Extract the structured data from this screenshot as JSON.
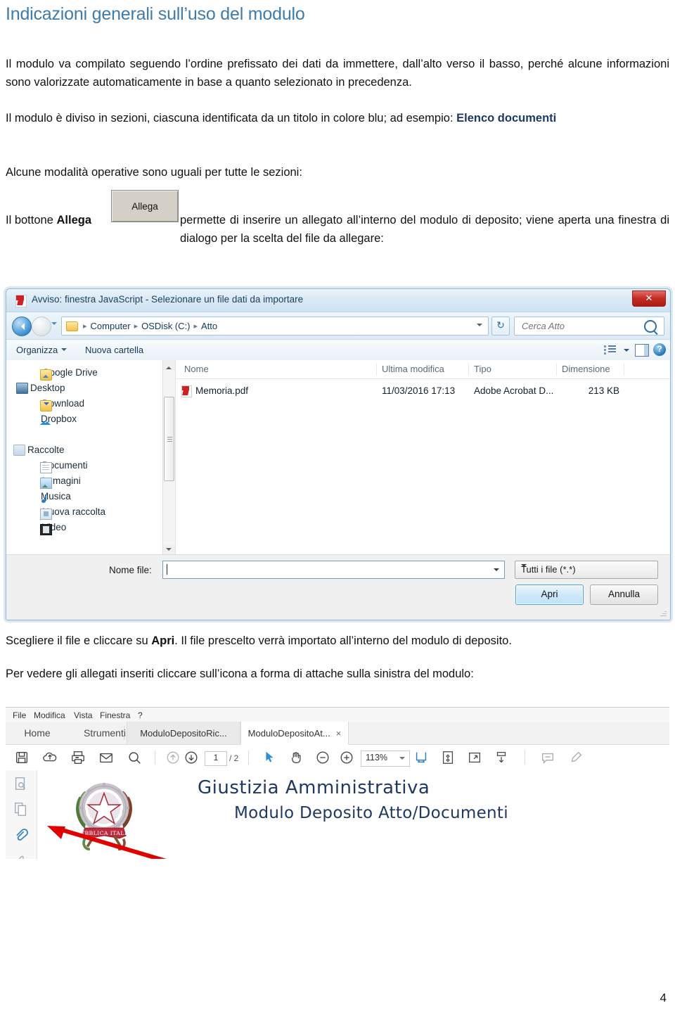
{
  "document": {
    "heading": "Indicazioni generali sull’uso del modulo",
    "para1": "Il modulo va compilato seguendo l’ordine prefissato dei dati da immettere, dall’alto verso il basso, perché alcune informazioni sono valorizzate automaticamente in base a quanto selezionato in precedenza.",
    "para2_a": "Il modulo è diviso in sezioni, ciascuna identificata da un titolo in colore blu; ad esempio: ",
    "para2_b": "Elenco documenti",
    "para3": "Alcune modalità operative sono uguali per tutte le sezioni:",
    "para4_a": "Il bottone ",
    "para4_b": "Allega",
    "para4_c": "permette di inserire un allegato all’interno del modulo di deposito; viene aperta una finestra di dialogo per la scelta del file da allegare:",
    "para5_a": "Scegliere il file e cliccare su ",
    "para5_b": "Apri",
    "para5_c": ". Il file prescelto verrà importato all’interno del modulo di deposito.",
    "para6": "Per vedere gli allegati inseriti cliccare sull’icona a forma di attache sulla sinistra del modulo:",
    "page_number": "4",
    "allega_button": "Allega",
    "heading_color": "#3E7CAD",
    "accent_navy": "#1F3864"
  },
  "file_dialog": {
    "title": "Avviso: finestra JavaScript - Selezionare un file dati da importare",
    "close_label": "✕",
    "breadcrumbs": [
      "Computer",
      "OSDisk (C:)",
      "Atto"
    ],
    "breadcrumb_separator": "▸",
    "search_placeholder": "Cerca Atto",
    "refresh_label": "↻",
    "help_label": "?",
    "commands": {
      "organize": "Organizza",
      "new_folder": "Nuova cartella"
    },
    "nav_pane": [
      {
        "label": "Google Drive",
        "icon": "gdrive-icon"
      },
      {
        "label": "Desktop",
        "icon": "desktop-icon"
      },
      {
        "label": "Download",
        "icon": "download-icon"
      },
      {
        "label": "Dropbox",
        "icon": "dropbox-icon"
      },
      {
        "label": "Raccolte",
        "icon": "libraries-icon"
      },
      {
        "label": "Documenti",
        "icon": "documents-icon"
      },
      {
        "label": "Immagini",
        "icon": "pictures-icon"
      },
      {
        "label": "Musica",
        "icon": "music-icon"
      },
      {
        "label": "Nuova raccolta",
        "icon": "new-library-icon"
      },
      {
        "label": "Video",
        "icon": "video-icon"
      }
    ],
    "columns": [
      "Nome",
      "Ultima modifica",
      "Tipo",
      "Dimensione"
    ],
    "files": [
      {
        "name": "Memoria.pdf",
        "modified": "11/03/2016 17:13",
        "type": "Adobe Acrobat D...",
        "size": "213 KB"
      }
    ],
    "footer": {
      "filename_label": "Nome file:",
      "filename_value": "",
      "filetype_value": "Tutti i file (*.*)",
      "open_button": "Apri",
      "cancel_button": "Annulla"
    }
  },
  "acrobat": {
    "menu": [
      "File",
      "Modifica",
      "Vista",
      "Finestra",
      "?"
    ],
    "tabs": [
      {
        "label": "Home",
        "active": false,
        "closable": false
      },
      {
        "label": "Strumenti",
        "active": false,
        "closable": false
      },
      {
        "label": "ModuloDepositoRic...",
        "active": false,
        "closable": false
      },
      {
        "label": "ModuloDepositoAt...",
        "active": true,
        "closable": true
      }
    ],
    "tab_close": "×",
    "toolbar_icons": [
      "save-icon",
      "upload-cloud-icon",
      "print-icon",
      "email-icon",
      "search-icon",
      "page-up-icon",
      "page-down-icon",
      "select-cursor-icon",
      "hand-tool-icon",
      "zoom-out-icon",
      "zoom-in-icon",
      "fit-width-icon",
      "page-thumbnail-icon",
      "fit-page-icon",
      "download-form-icon",
      "comment-icon",
      "highlight-icon"
    ],
    "page_current": "1",
    "page_total": "/ 2",
    "zoom_level": "113%",
    "left_rail_icons": [
      "page-search-icon",
      "page-copy-icon",
      "attachment-paperclip-icon",
      "signature-icon"
    ],
    "pdf_title": "Giustizia Amministrativa",
    "pdf_subtitle": "Modulo Deposito Atto/Documenti"
  }
}
